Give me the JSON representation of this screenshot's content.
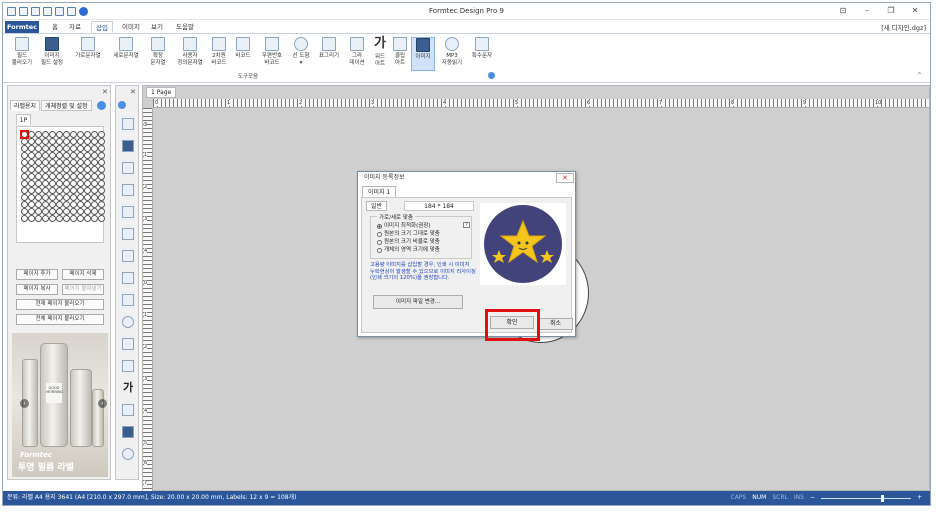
{
  "window": {
    "title": "Formtec Design Pro 9",
    "new_doc": "[새 디자인.dgz]",
    "controls": [
      "⊡",
      "–",
      "❐",
      "✕"
    ]
  },
  "ribbon_tabs": [
    {
      "label": "Formtec"
    },
    {
      "label": "홈"
    },
    {
      "label": "자료"
    },
    {
      "label": "삽입"
    },
    {
      "label": "이미지"
    },
    {
      "label": "보기"
    },
    {
      "label": "도움말"
    }
  ],
  "ribbon_buttons": [
    {
      "l1": "필드",
      "l2": "불러오기"
    },
    {
      "l1": "이미지",
      "l2": "필드 설정"
    },
    {
      "l1": "가로문자열",
      "l2": ""
    },
    {
      "l1": "세로문자열",
      "l2": ""
    },
    {
      "l1": "확장",
      "l2": "문자열"
    },
    {
      "l1": "사용자",
      "l2": "정의문자열"
    },
    {
      "l1": "2차원",
      "l2": "바코드"
    },
    {
      "l1": "바코드",
      "l2": ""
    },
    {
      "l1": "우편번호",
      "l2": "바코드"
    },
    {
      "l1": "선 도형",
      "l2": "▾"
    },
    {
      "l1": "표그리기",
      "l2": ""
    },
    {
      "l1": "그라",
      "l2": "데이션"
    },
    {
      "l1": "워드",
      "l2": "아트"
    },
    {
      "l1": "클립",
      "l2": "아트"
    },
    {
      "l1": "이미지",
      "l2": ""
    },
    {
      "l1": "MP3",
      "l2": "자동읽기"
    },
    {
      "l1": "특수문자",
      "l2": ""
    }
  ],
  "ribbon_group": "도구모음",
  "left_panel": {
    "tabs": [
      "라벨용지",
      "개체정렬 및 설정"
    ],
    "page_tab": "1P",
    "buttons": [
      "페이지 추가",
      "페이지 삭제",
      "페이지 복사",
      "페이지 붙여넣기",
      "현재 페이지 불러오기",
      "전체 페이지 불러오기"
    ],
    "row_numbers": [
      "1",
      "4",
      "7",
      "10"
    ],
    "promo": {
      "logo": "Formtec",
      "caption": "투명 필름 라벨",
      "label_text": "GOOD MORNING"
    }
  },
  "canvas": {
    "tab": "1 Page",
    "h_ruler": [
      "0",
      "1",
      "2",
      "3",
      "4",
      "5",
      "6",
      "7",
      "8",
      "9",
      "10"
    ],
    "v_ruler": [
      "3",
      "1",
      "2",
      "3",
      "4",
      "0",
      "1",
      "2",
      "3",
      "4",
      "5",
      "6",
      "7"
    ]
  },
  "dialog": {
    "title": "이미지 등록정보",
    "tab": "이미지 1",
    "subtab": "일반",
    "size": "184 * 184",
    "fit_group": "가로/세로 맞춤",
    "options": [
      "이미지 최적화(권장)",
      "원본의 크기 그대로 맞춤",
      "원본의 크기 비율로 맞춤",
      "개체의 영역 크기에 맞춤"
    ],
    "selected_option": 0,
    "help": "?",
    "warning": "고용량 이미지를 삽입할 경우, 인쇄 시 이미지 누락현상이 발생할 수 있으므로 이미지 리사이징(인쇄 크기의 120%)을 권장합니다.",
    "change_button": "이미지 파일 변경...",
    "ok": "확인",
    "cancel": "취소"
  },
  "status": {
    "text": "분류: 라벨 A4 용지 3641 (A4 [210.0 x 297.0 mm], Size: 20.00 x 20.00 mm, Labels: 12 x 9 = 108개)",
    "indicators": [
      "CAPS",
      "NUM",
      "SCRL",
      "INS"
    ],
    "zoom_minus": "−",
    "zoom_plus": "+"
  },
  "colors": {
    "accent": "#2b579a",
    "highlight": "#e01010",
    "star_bg": "#41437a",
    "star": "#f4c51c"
  }
}
